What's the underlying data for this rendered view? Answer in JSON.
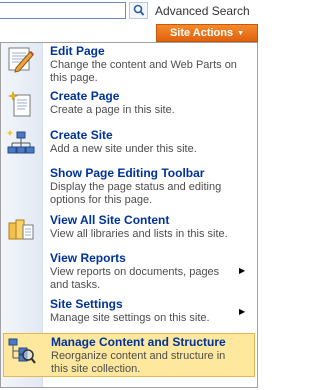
{
  "header": {
    "search_value": "",
    "advanced_search_label": "Advanced Search",
    "site_actions_label": "Site Actions"
  },
  "menu": {
    "items": [
      {
        "title": "Edit Page",
        "desc": "Change the content and Web Parts on this page.",
        "icon": "edit-page-icon",
        "has_submenu": false
      },
      {
        "title": "Create Page",
        "desc": "Create a page in this site.",
        "icon": "create-page-icon",
        "has_submenu": false
      },
      {
        "title": "Create Site",
        "desc": "Add a new site under this site.",
        "icon": "create-site-icon",
        "has_submenu": false
      },
      {
        "title": "Show Page Editing Toolbar",
        "desc": "Display the page status and editing options for this page.",
        "icon": "",
        "has_submenu": false
      },
      {
        "title": "View All Site Content",
        "desc": "View all libraries and lists in this site.",
        "icon": "view-all-content-icon",
        "has_submenu": false
      },
      {
        "title": "View Reports",
        "desc": "View reports on documents, pages and tasks.",
        "icon": "",
        "has_submenu": true
      },
      {
        "title": "Site Settings",
        "desc": "Manage site settings on this site.",
        "icon": "",
        "has_submenu": true
      },
      {
        "title": "Manage Content and Structure",
        "desc": "Reorganize content and structure in this site collection.",
        "icon": "manage-content-icon",
        "has_submenu": false,
        "selected": true
      }
    ]
  },
  "colors": {
    "accent_orange": "#e8731a",
    "title_blue": "#003399",
    "highlight": "#fde89d"
  }
}
